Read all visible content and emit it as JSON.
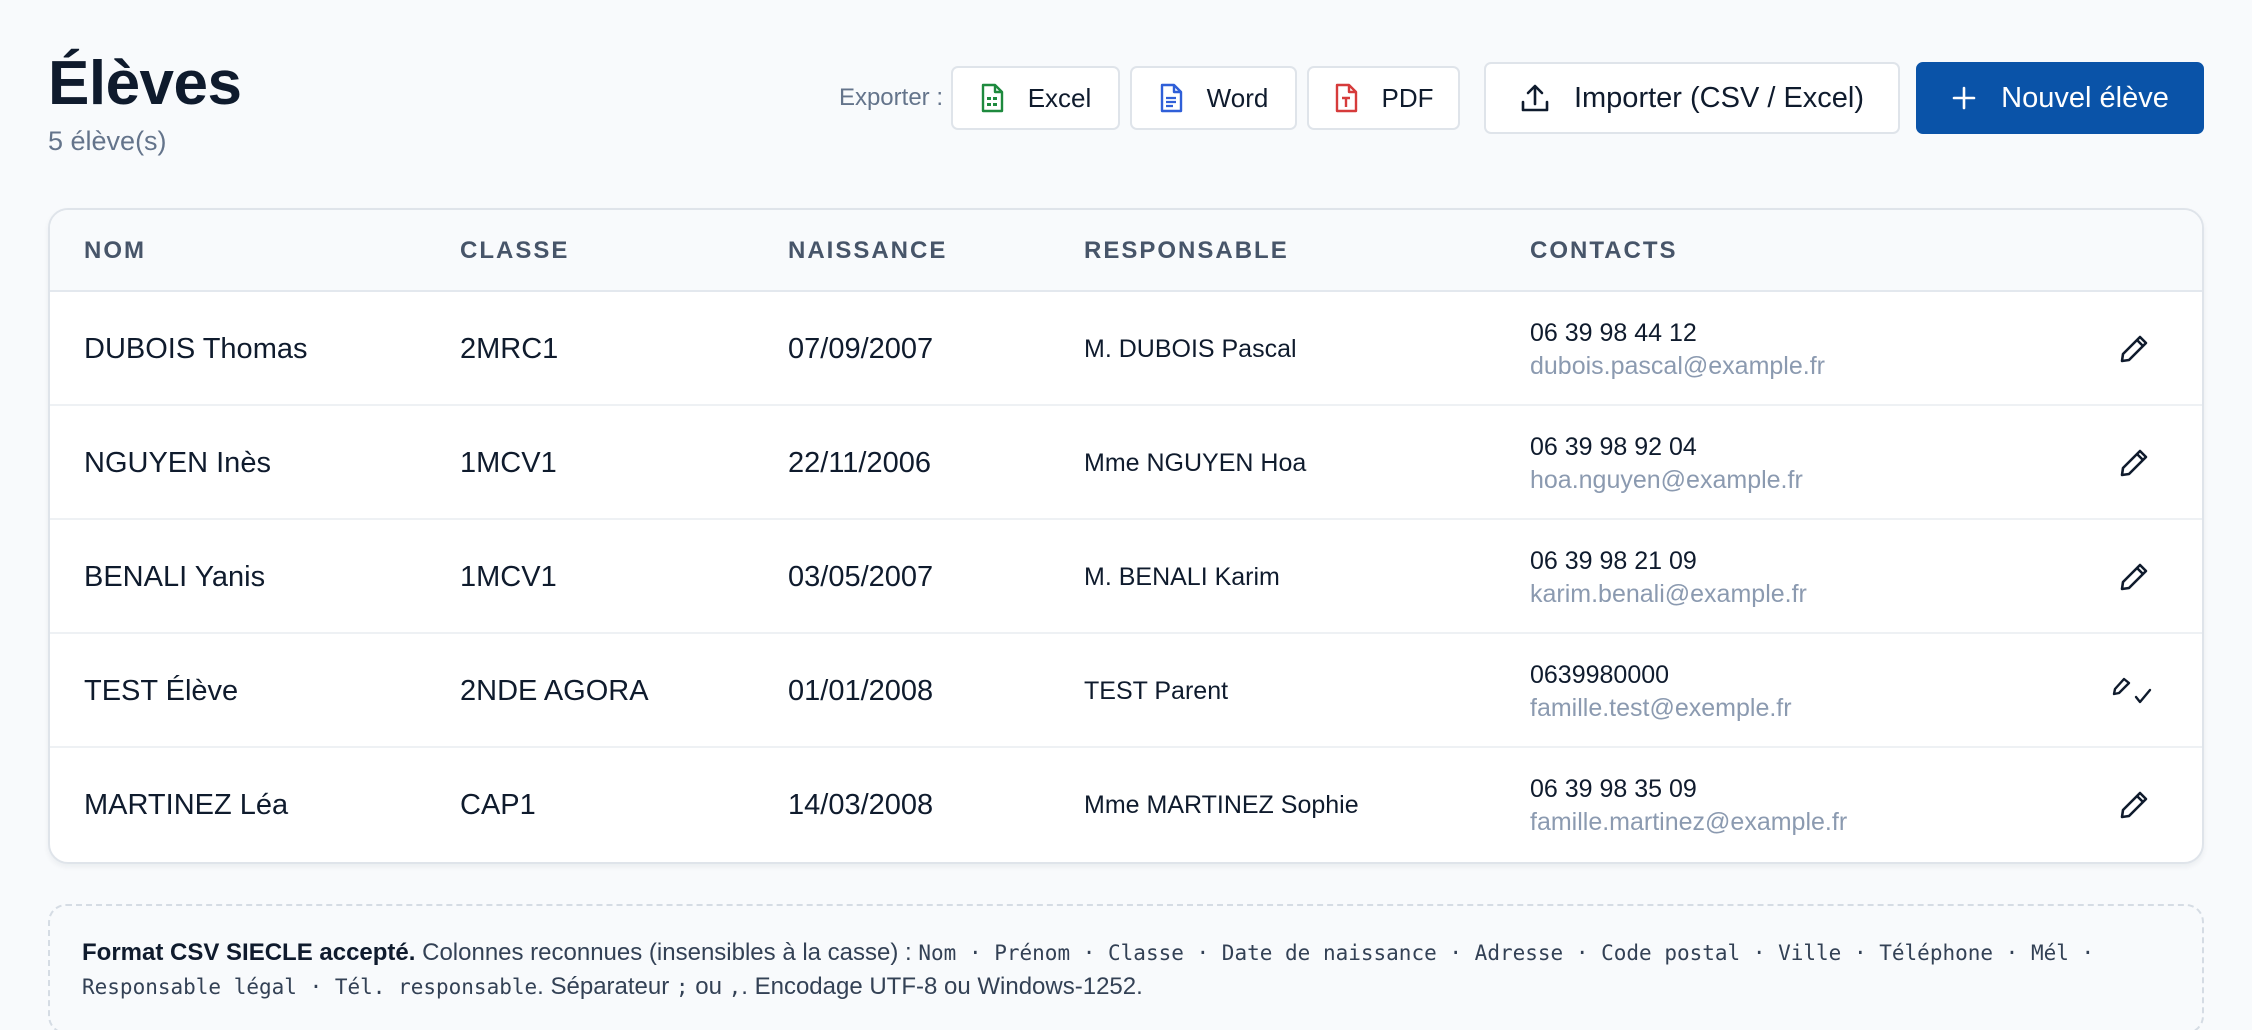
{
  "header": {
    "title": "Élèves",
    "subtitle": "5 élève(s)"
  },
  "toolbar": {
    "export_label": "Exporter :",
    "excel_label": "Excel",
    "word_label": "Word",
    "pdf_label": "PDF",
    "import_label": "Importer (CSV / Excel)",
    "new_label": "Nouvel élève"
  },
  "colors": {
    "primary": "#0a53a8",
    "excel": "#1e8a3e",
    "word": "#2f5fd8",
    "pdf": "#d63b3b"
  },
  "table": {
    "columns": [
      "NOM",
      "CLASSE",
      "NAISSANCE",
      "RESPONSABLE",
      "CONTACTS"
    ],
    "rows": [
      {
        "nom": "DUBOIS Thomas",
        "classe": "2MRC1",
        "naissance": "07/09/2007",
        "responsable": "M. DUBOIS Pascal",
        "phone": "06 39 98 44 12",
        "email": "dubois.pascal@example.fr",
        "icon": "pencil-icon"
      },
      {
        "nom": "NGUYEN Inès",
        "classe": "1MCV1",
        "naissance": "22/11/2006",
        "responsable": "Mme NGUYEN Hoa",
        "phone": "06 39 98 92 04",
        "email": "hoa.nguyen@example.fr",
        "icon": "pencil-icon"
      },
      {
        "nom": "BENALI Yanis",
        "classe": "1MCV1",
        "naissance": "03/05/2007",
        "responsable": "M. BENALI Karim",
        "phone": "06 39 98 21 09",
        "email": "karim.benali@example.fr",
        "icon": "pencil-icon"
      },
      {
        "nom": "TEST Élève",
        "classe": "2NDE AGORA",
        "naissance": "01/01/2008",
        "responsable": "TEST Parent",
        "phone": "0639980000",
        "email": "famille.test@exemple.fr",
        "icon": "edit-check-icon"
      },
      {
        "nom": "MARTINEZ Léa",
        "classe": "CAP1",
        "naissance": "14/03/2008",
        "responsable": "Mme MARTINEZ Sophie",
        "phone": "06 39 98 35 09",
        "email": "famille.martinez@example.fr",
        "icon": "pencil-icon"
      }
    ]
  },
  "note": {
    "bold": "Format CSV SIECLE accepté.",
    "text1": " Colonnes reconnues (insensibles à la casse) : ",
    "columns": "Nom · Prénom · Classe · Date de naissance · Adresse · Code postal · Ville · Téléphone · Mél · Responsable légal · Tél. responsable",
    "text2": ". Séparateur ",
    "sep1": ";",
    "text3": " ou ",
    "sep2": ",",
    "text4": ". Encodage UTF-8 ou Windows-1252."
  }
}
